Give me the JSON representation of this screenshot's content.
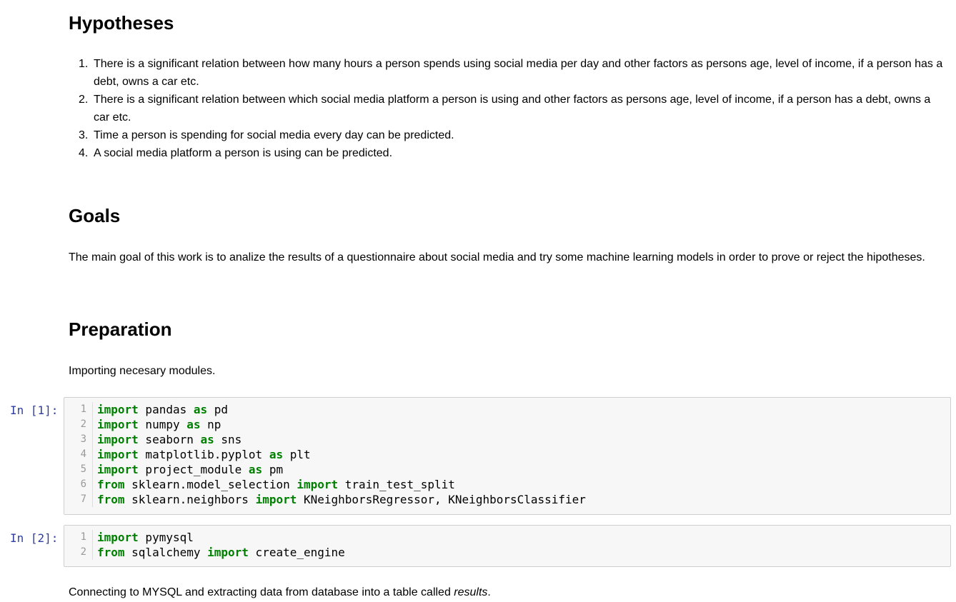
{
  "hypotheses": {
    "heading": "Hypotheses",
    "items": [
      {
        "num": "1.",
        "text": "There is a significant relation between how many hours a person spends using social media per day and other factors as persons age, level of income, if a person has a debt, owns a car etc."
      },
      {
        "num": "2.",
        "text": "There is a significant relation between which social media platform a person is using and other factors as persons age, level of income, if a person has a debt, owns a car etc."
      },
      {
        "num": "3.",
        "text": "Time a person is spending for social media every day can be predicted."
      },
      {
        "num": "4.",
        "text": "A social media platform a person is using can be predicted."
      }
    ]
  },
  "goals": {
    "heading": "Goals",
    "text": "The main goal of this work is to analize the results of a questionnaire about social media and try some machine learning models in order to prove or reject the hipotheses."
  },
  "preparation": {
    "heading": "Preparation",
    "intro": "Importing necesary modules.",
    "outro_prefix": "Connecting to MYSQL and extracting data from database into a table called ",
    "outro_emph": "results",
    "outro_suffix": "."
  },
  "cells": [
    {
      "prompt": "In [1]:",
      "lines": [
        {
          "n": "1",
          "tokens": [
            {
              "t": "import",
              "kw": true
            },
            {
              "t": " pandas "
            },
            {
              "t": "as",
              "kw": true
            },
            {
              "t": " pd"
            }
          ]
        },
        {
          "n": "2",
          "tokens": [
            {
              "t": "import",
              "kw": true
            },
            {
              "t": " numpy "
            },
            {
              "t": "as",
              "kw": true
            },
            {
              "t": " np"
            }
          ]
        },
        {
          "n": "3",
          "tokens": [
            {
              "t": "import",
              "kw": true
            },
            {
              "t": " seaborn "
            },
            {
              "t": "as",
              "kw": true
            },
            {
              "t": " sns"
            }
          ]
        },
        {
          "n": "4",
          "tokens": [
            {
              "t": "import",
              "kw": true
            },
            {
              "t": " matplotlib.pyplot "
            },
            {
              "t": "as",
              "kw": true
            },
            {
              "t": " plt"
            }
          ]
        },
        {
          "n": "5",
          "tokens": [
            {
              "t": "import",
              "kw": true
            },
            {
              "t": " project_module "
            },
            {
              "t": "as",
              "kw": true
            },
            {
              "t": " pm"
            }
          ]
        },
        {
          "n": "6",
          "tokens": [
            {
              "t": "from",
              "kw": true
            },
            {
              "t": " sklearn.model_selection "
            },
            {
              "t": "import",
              "kw": true
            },
            {
              "t": " train_test_split"
            }
          ]
        },
        {
          "n": "7",
          "tokens": [
            {
              "t": "from",
              "kw": true
            },
            {
              "t": " sklearn.neighbors "
            },
            {
              "t": "import",
              "kw": true
            },
            {
              "t": " KNeighborsRegressor, KNeighborsClassifier"
            }
          ]
        }
      ]
    },
    {
      "prompt": "In [2]:",
      "lines": [
        {
          "n": "1",
          "tokens": [
            {
              "t": "import",
              "kw": true
            },
            {
              "t": " pymysql"
            }
          ]
        },
        {
          "n": "2",
          "tokens": [
            {
              "t": "from",
              "kw": true
            },
            {
              "t": " sqlalchemy "
            },
            {
              "t": "import",
              "kw": true
            },
            {
              "t": " create_engine"
            }
          ]
        }
      ]
    }
  ],
  "colors": {
    "keyword": "#008000",
    "prompt": "#303f9f",
    "cell_bg": "#f7f7f7",
    "cell_border": "#cfcfcf"
  }
}
